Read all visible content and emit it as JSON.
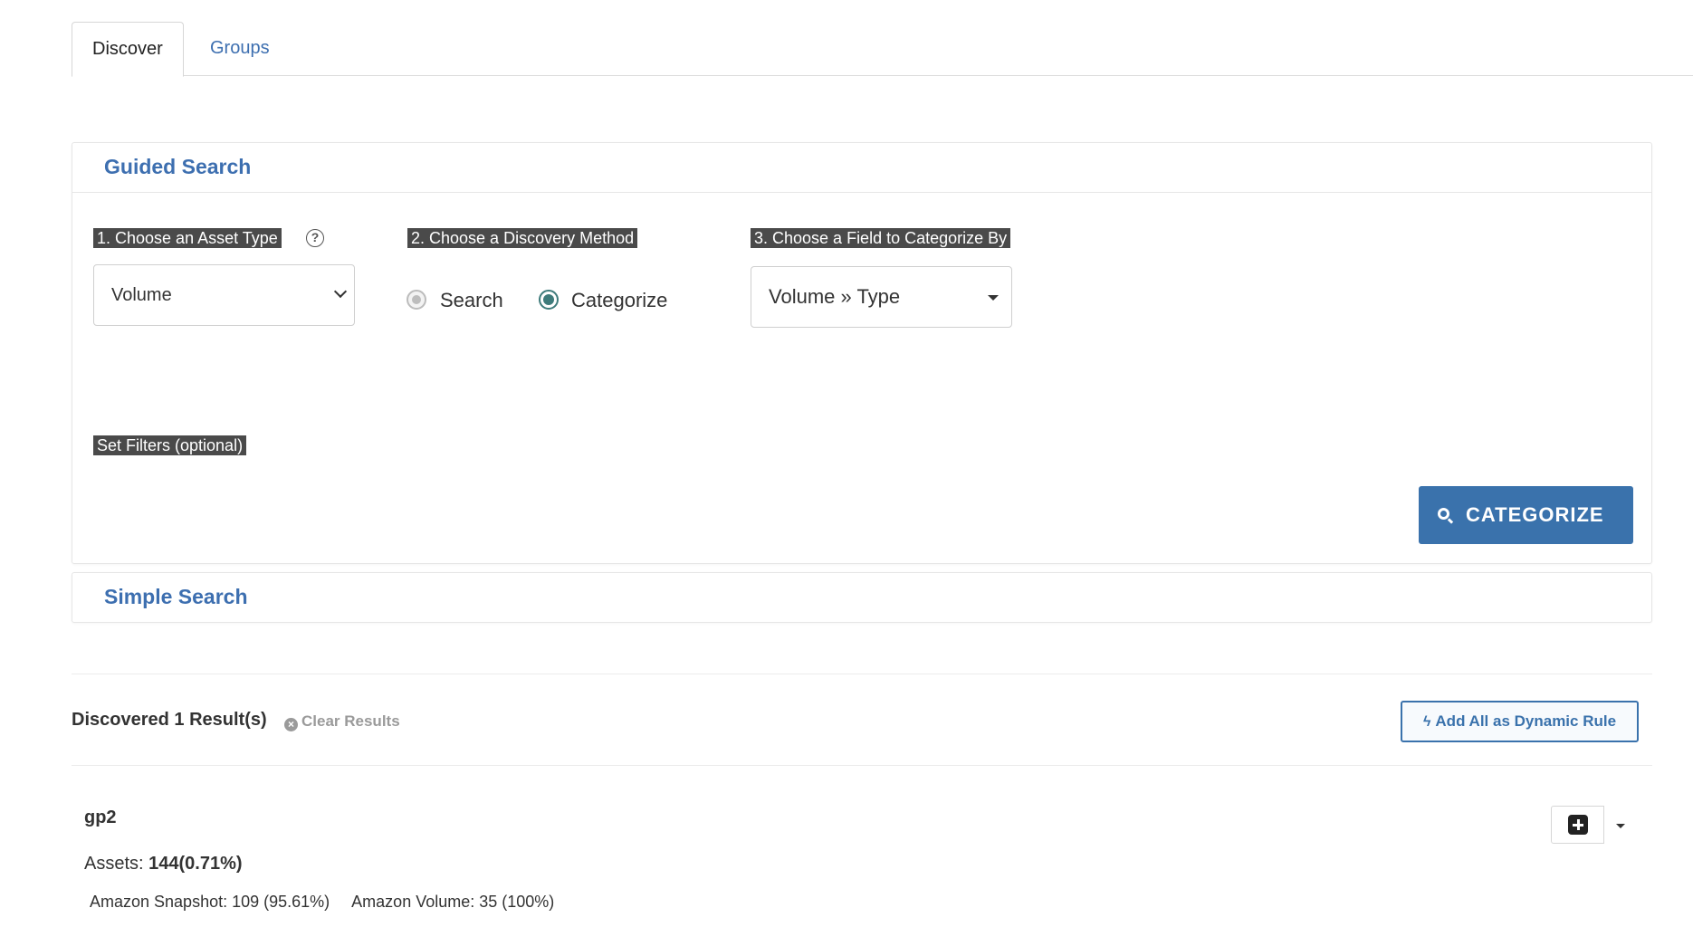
{
  "tabs": [
    {
      "label": "Discover",
      "active": true
    },
    {
      "label": "Groups",
      "active": false
    }
  ],
  "guided_search": {
    "title": "Guided Search",
    "step1": {
      "label": "1. Choose an Asset Type",
      "help_icon": "question-circle-icon",
      "value": "Volume"
    },
    "step2": {
      "label": "2. Choose a Discovery Method",
      "options": [
        {
          "label": "Search",
          "checked": false
        },
        {
          "label": "Categorize",
          "checked": true
        }
      ]
    },
    "step3": {
      "label": "3. Choose a Field to Categorize By",
      "value": "Volume » Type"
    },
    "filters_label": "Set Filters (optional)",
    "submit": {
      "label": "CATEGORIZE",
      "icon": "search-icon"
    }
  },
  "simple_search": {
    "title": "Simple Search"
  },
  "results": {
    "title": "Discovered 1 Result(s)",
    "clear_label": "Clear Results",
    "clear_icon": "times-circle-icon",
    "dynamic_rule_label": "Add All as Dynamic Rule",
    "dynamic_rule_icon": "bolt-icon",
    "items": [
      {
        "name": "gp2",
        "assets_label": "Assets:",
        "assets_value": "144(0.71%)",
        "breakdown": [
          "Amazon Snapshot: 109 (95.61%)",
          "Amazon Volume: 35 (100%)"
        ]
      }
    ]
  },
  "colors": {
    "accent": "#3a72ac",
    "link": "#3d6fb0",
    "label_bg": "#4a4a4a",
    "radio_checked": "#3e7b7b"
  }
}
